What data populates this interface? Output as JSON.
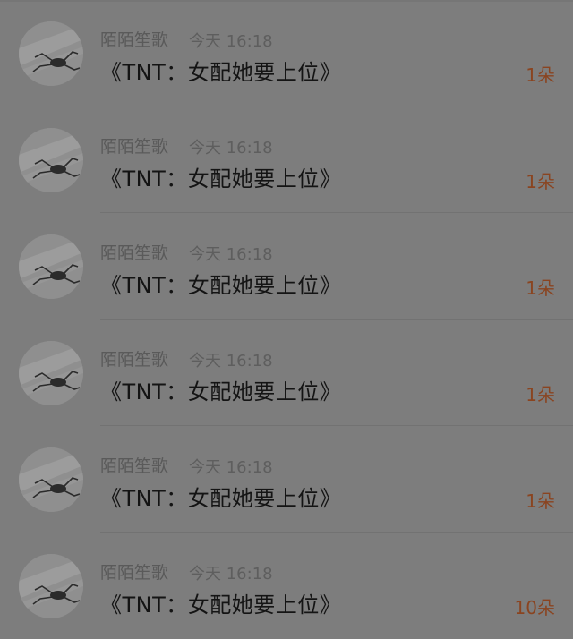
{
  "items": [
    {
      "name": "陌陌笙歌",
      "time": "今天 16:18",
      "title": "《TNT：女配她要上位》",
      "amount": "1朵"
    },
    {
      "name": "陌陌笙歌",
      "time": "今天 16:18",
      "title": "《TNT：女配她要上位》",
      "amount": "1朵"
    },
    {
      "name": "陌陌笙歌",
      "time": "今天 16:18",
      "title": "《TNT：女配她要上位》",
      "amount": "1朵"
    },
    {
      "name": "陌陌笙歌",
      "time": "今天 16:18",
      "title": "《TNT：女配她要上位》",
      "amount": "1朵"
    },
    {
      "name": "陌陌笙歌",
      "time": "今天 16:18",
      "title": "《TNT：女配她要上位》",
      "amount": "1朵"
    },
    {
      "name": "陌陌笙歌",
      "time": "今天 16:18",
      "title": "《TNT：女配她要上位》",
      "amount": "10朵"
    }
  ],
  "colors": {
    "background": "#7d7d7d",
    "amount": "#8a4420",
    "title": "#141414",
    "meta": "#5a5a5a"
  }
}
